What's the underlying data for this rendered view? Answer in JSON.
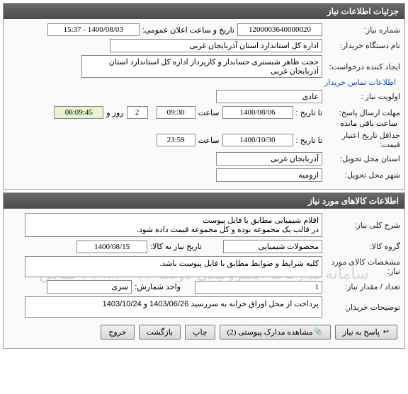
{
  "panel1": {
    "title": "جزئیات اطلاعات نیاز",
    "need_no_label": "شماره نیاز:",
    "need_no": "1200003640000020",
    "announce_label": "تاریخ و ساعت اعلان عمومی:",
    "announce_val": "1400/08/03 - 15:37",
    "buyer_label": "نام دستگاه خریدار:",
    "buyer_val": "اداره کل استاندارد استان آذربایجان غربی",
    "creator_label": "ایجاد کننده درخواست:",
    "creator_val": "حجت ظاهر شبستری حسابدار و کارپرداز اداره کل استاندارد استان آذربایجان غربی",
    "contact_link": "اطلاعات تماس خریدار",
    "priority_label": "اولویت نیاز :",
    "priority_val": "عادی",
    "deadline_label": "مهلت ارسال پاسخ:",
    "to_date_label": "تا تاریخ :",
    "deadline_date": "1400/08/06",
    "time_label": "ساعت",
    "deadline_time": "09:30",
    "days_val": "2",
    "days_label": "روز و",
    "remaining_time": "08:09:45",
    "remaining_label": "ساعت باقی مانده",
    "validity_label": "حداقل تاریخ اعتبار قیمت:",
    "validity_date": "1400/10/30",
    "validity_time": "23:59",
    "province_label": "استان محل تحویل:",
    "province_val": "آذربایجان غربی",
    "city_label": "شهر محل تحویل:",
    "city_val": "ارومیه"
  },
  "panel2": {
    "title": "اطلاعات کالاهای مورد نیاز",
    "desc_label": "شرح کلی نیاز:",
    "desc_val": "اقلام شیمیایی مطابق با فایل پیوست\nدر قالب یک مجموعه بوده و کل مجموعه قیمت داده شود.",
    "group_label": "گروه کالا:",
    "group_val": "محصولات شیمیایی",
    "need_date_label": "تاریخ نیاز به کالا:",
    "need_date_val": "1400/08/15",
    "spec_label": "مشخصات کالای مورد نیاز:",
    "spec_val": "کلیه شرایط و ضوابط مطابق با فایل پیوست باشد.",
    "qty_label": "تعداد / مقدار نیاز:",
    "qty_val": "1",
    "unit_label": "واحد شمارش:",
    "unit_val": "سری",
    "buyer_note_label": "توضیحات خریدار:",
    "buyer_note_val": "پرداخت از محل اوراق خزانه به سررسید 1403/06/26 و 1403/10/24",
    "watermark": "سامانه تدارکات الکترونیکی دولت\n۰۲۱-۴۱۹۳۴ تماس"
  },
  "buttons": {
    "respond": "پاسخ به نیاز",
    "attachments": "مشاهده مدارک پیوستی (2)",
    "print": "چاپ",
    "back": "بازگشت",
    "exit": "خروج"
  }
}
